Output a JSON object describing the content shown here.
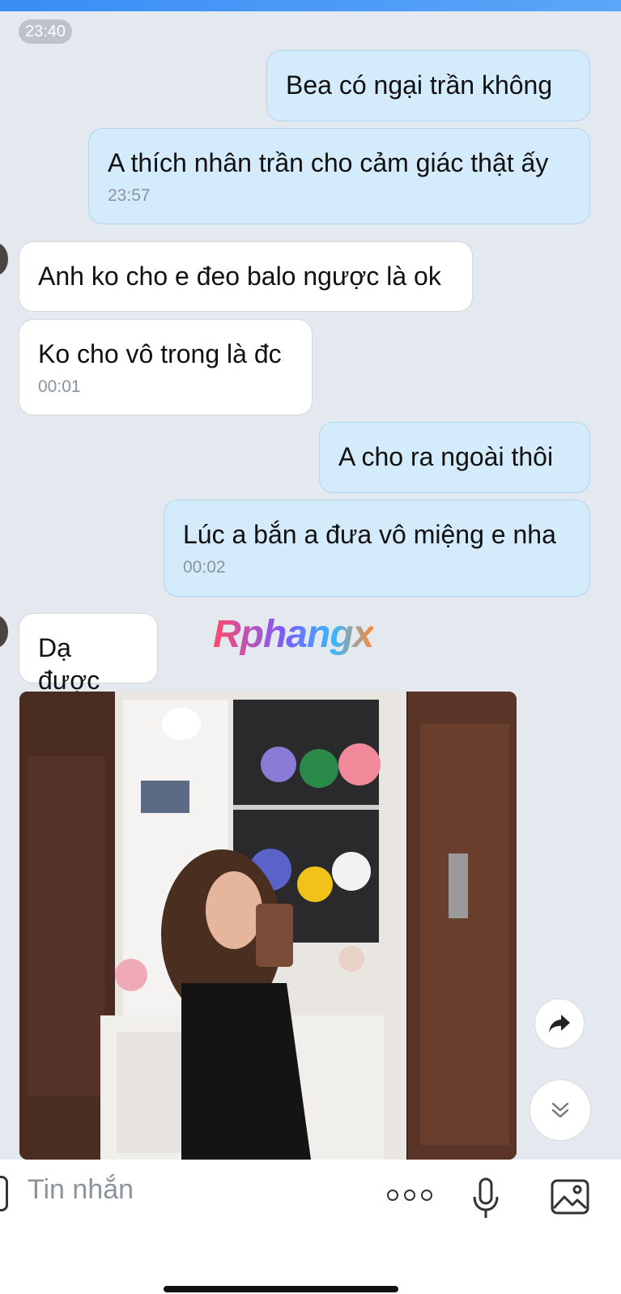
{
  "header": {
    "time_divider": "23:40"
  },
  "messages": [
    {
      "side": "outgoing",
      "text": "Bea có ngại trần không",
      "time": ""
    },
    {
      "side": "outgoing",
      "text": "A thích nhân trần cho cảm giác thật ấy",
      "time": "23:57"
    },
    {
      "side": "incoming",
      "text": "Anh ko cho e đeo balo ngược là ok",
      "time": ""
    },
    {
      "side": "incoming",
      "text": "Ko cho vô trong là đc",
      "time": "00:01"
    },
    {
      "side": "outgoing",
      "text": "A cho ra ngoài thôi",
      "time": ""
    },
    {
      "side": "outgoing",
      "text": "Lúc a bắn a đưa vô miệng e nha",
      "time": "00:02"
    },
    {
      "side": "incoming",
      "text": "Dạ được",
      "time": ""
    }
  ],
  "watermark": "Rphangx",
  "photo_message": {
    "icon": "photo-attachment"
  },
  "actions": {
    "share_icon": "share-arrow-icon",
    "scroll_icon": "scroll-down-double-chevron-icon"
  },
  "composer": {
    "placeholder": "Tin nhắn",
    "more_icon": "more-dots-icon",
    "mic_icon": "microphone-icon",
    "image_icon": "image-icon"
  },
  "colors": {
    "outgoing_bubble": "#d4ebfb",
    "incoming_bubble": "#ffffff",
    "background": "#e4e8ef",
    "accent": "#3a8df5"
  }
}
